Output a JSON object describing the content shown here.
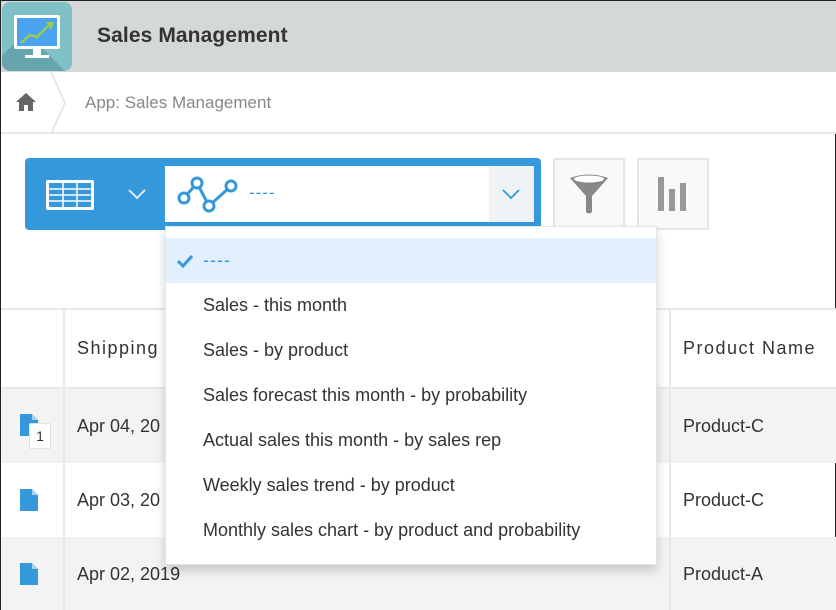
{
  "header": {
    "app_icon": "monitor-chart-icon",
    "title": "Sales Management"
  },
  "breadcrumb": {
    "home_icon": "home-icon",
    "items": [
      {
        "label": "App: Sales Management"
      }
    ]
  },
  "toolbar": {
    "view_selector": {
      "icon": "table-view-icon",
      "chevron": "chevron-down-icon"
    },
    "graph_selector": {
      "icon": "line-graph-icon",
      "value": "----",
      "chevron": "chevron-down-icon"
    },
    "filter_button": {
      "icon": "funnel-icon"
    },
    "chart_button": {
      "icon": "bar-chart-icon"
    }
  },
  "graph_dropdown": {
    "options": [
      {
        "label": "----",
        "selected": true
      },
      {
        "label": "Sales - this month",
        "selected": false
      },
      {
        "label": "Sales - by product",
        "selected": false
      },
      {
        "label": "Sales forecast this month - by probability",
        "selected": false
      },
      {
        "label": "Actual sales this month - by sales rep",
        "selected": false
      },
      {
        "label": "Weekly sales trend - by product",
        "selected": false
      },
      {
        "label": "Monthly sales chart - by product and probability",
        "selected": false
      }
    ]
  },
  "table": {
    "columns": [
      "",
      "Shipping",
      "Product Name"
    ],
    "rows": [
      {
        "shipping": "Apr 04, 20",
        "product": "Product-C",
        "comments": "1"
      },
      {
        "shipping": "Apr 03, 20",
        "product": "Product-C",
        "comments": null
      },
      {
        "shipping": "Apr 02, 2019",
        "product": "Product-A",
        "comments": null
      }
    ]
  },
  "colors": {
    "accent": "#3498db",
    "header_bg": "#d4d8d9",
    "selected_option_bg": "#e1f0fc",
    "row_alt_bg": "#f3f3f3"
  }
}
